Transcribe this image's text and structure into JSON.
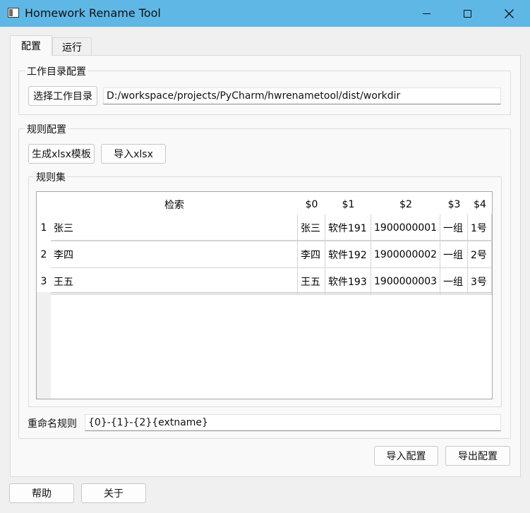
{
  "window": {
    "title": "Homework Rename Tool",
    "controls": [
      "minimize",
      "maximize",
      "close"
    ]
  },
  "tabs": [
    {
      "label": "配置",
      "active": true
    },
    {
      "label": "运行",
      "active": false
    }
  ],
  "workdir_group": {
    "title": "工作目录配置",
    "select_button": "选择工作目录",
    "path_value": "D:/workspace/projects/PyCharm/hwrenametool/dist/workdir"
  },
  "rules_group": {
    "title": "规则配置",
    "gen_template_button": "生成xlsx模板",
    "import_xlsx_button": "导入xlsx",
    "ruleset": {
      "title": "规则集",
      "columns": [
        "检索",
        "$0",
        "$1",
        "$2",
        "$3",
        "$4"
      ],
      "row_numbers": [
        "1",
        "2",
        "3"
      ],
      "rows": [
        [
          "张三",
          "张三",
          "软件191",
          "1900000001",
          "一组",
          "1号"
        ],
        [
          "李四",
          "李四",
          "软件192",
          "1900000002",
          "一组",
          "2号"
        ],
        [
          "王五",
          "王五",
          "软件193",
          "1900000003",
          "一组",
          "3号"
        ]
      ]
    },
    "rename_rule_label": "重命名规则",
    "rename_rule_value": "{0}-{1}-{2}{extname}"
  },
  "actions": {
    "import_config": "导入配置",
    "export_config": "导出配置"
  },
  "footer": {
    "help": "帮助",
    "about": "关于"
  },
  "colors": {
    "titlebar": "#5fb7e6",
    "window_bg": "#f0f0f0",
    "panel_bg": "#f9f9f9"
  }
}
